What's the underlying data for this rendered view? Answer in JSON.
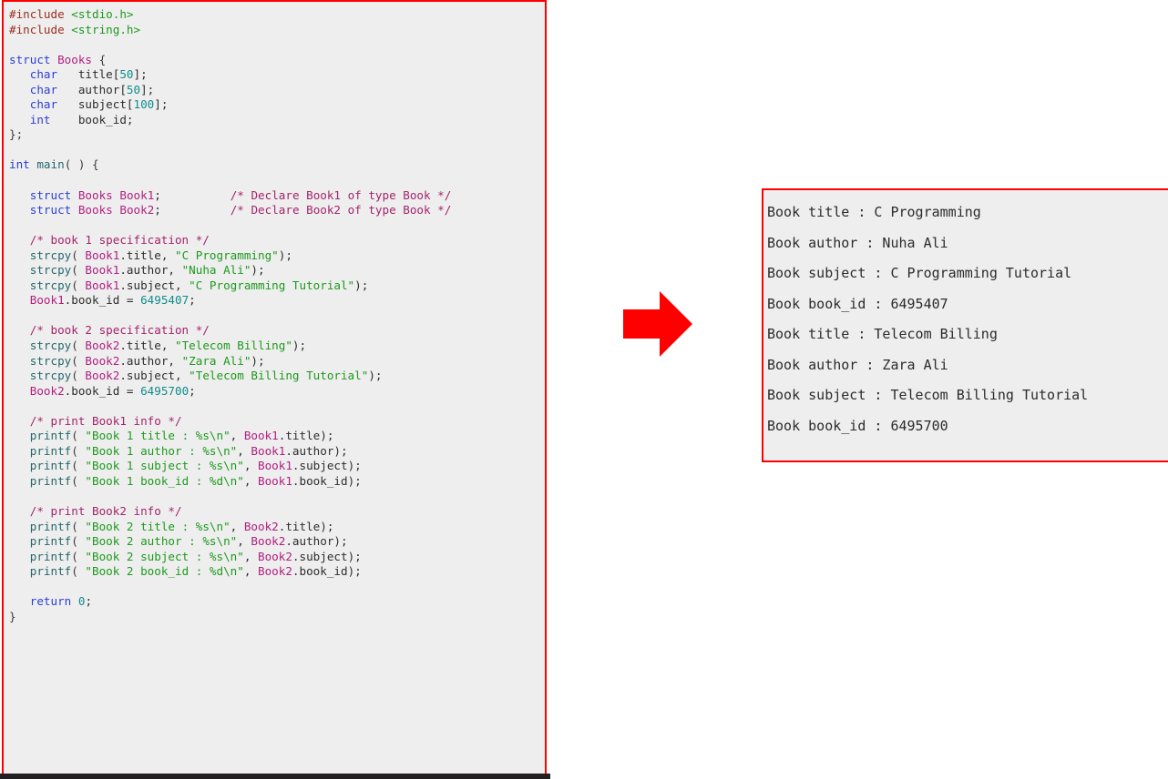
{
  "code_panel": {
    "language": "c",
    "border_color": "#fe0000",
    "background_color": "#eeeeee",
    "lines": [
      [
        {
          "t": "pre",
          "s": "#include "
        },
        {
          "t": "hdr",
          "s": "<stdio.h>"
        }
      ],
      [
        {
          "t": "pre",
          "s": "#include "
        },
        {
          "t": "hdr",
          "s": "<string.h>"
        }
      ],
      [],
      [
        {
          "t": "kw",
          "s": "struct"
        },
        {
          "t": "id",
          "s": " "
        },
        {
          "t": "type",
          "s": "Books"
        },
        {
          "t": "punc",
          "s": " {"
        }
      ],
      [
        {
          "t": "id",
          "s": "   "
        },
        {
          "t": "kw",
          "s": "char"
        },
        {
          "t": "id",
          "s": "   title["
        },
        {
          "t": "num",
          "s": "50"
        },
        {
          "t": "id",
          "s": "];"
        }
      ],
      [
        {
          "t": "id",
          "s": "   "
        },
        {
          "t": "kw",
          "s": "char"
        },
        {
          "t": "id",
          "s": "   author["
        },
        {
          "t": "num",
          "s": "50"
        },
        {
          "t": "id",
          "s": "];"
        }
      ],
      [
        {
          "t": "id",
          "s": "   "
        },
        {
          "t": "kw",
          "s": "char"
        },
        {
          "t": "id",
          "s": "   subject["
        },
        {
          "t": "num",
          "s": "100"
        },
        {
          "t": "id",
          "s": "];"
        }
      ],
      [
        {
          "t": "id",
          "s": "   "
        },
        {
          "t": "kw",
          "s": "int"
        },
        {
          "t": "id",
          "s": "    book_id;"
        }
      ],
      [
        {
          "t": "punc",
          "s": "};"
        }
      ],
      [],
      [
        {
          "t": "kw",
          "s": "int"
        },
        {
          "t": "id",
          "s": " "
        },
        {
          "t": "fn",
          "s": "main"
        },
        {
          "t": "punc",
          "s": "( ) {"
        }
      ],
      [],
      [
        {
          "t": "id",
          "s": "   "
        },
        {
          "t": "kw",
          "s": "struct"
        },
        {
          "t": "id",
          "s": " "
        },
        {
          "t": "type",
          "s": "Books"
        },
        {
          "t": "id",
          "s": " "
        },
        {
          "t": "type",
          "s": "Book1"
        },
        {
          "t": "id",
          "s": ";"
        },
        {
          "t": "id",
          "s": "          "
        },
        {
          "t": "cmt",
          "s": "/* Declare Book1 of type Book */"
        }
      ],
      [
        {
          "t": "id",
          "s": "   "
        },
        {
          "t": "kw",
          "s": "struct"
        },
        {
          "t": "id",
          "s": " "
        },
        {
          "t": "type",
          "s": "Books"
        },
        {
          "t": "id",
          "s": " "
        },
        {
          "t": "type",
          "s": "Book2"
        },
        {
          "t": "id",
          "s": ";"
        },
        {
          "t": "id",
          "s": "          "
        },
        {
          "t": "cmt",
          "s": "/* Declare Book2 of type Book */"
        }
      ],
      [],
      [
        {
          "t": "id",
          "s": "   "
        },
        {
          "t": "cmt",
          "s": "/* book 1 specification */"
        }
      ],
      [
        {
          "t": "id",
          "s": "   "
        },
        {
          "t": "fn",
          "s": "strcpy"
        },
        {
          "t": "punc",
          "s": "( "
        },
        {
          "t": "type",
          "s": "Book1"
        },
        {
          "t": "id",
          "s": ".title, "
        },
        {
          "t": "str",
          "s": "\"C Programming\""
        },
        {
          "t": "id",
          "s": ");"
        }
      ],
      [
        {
          "t": "id",
          "s": "   "
        },
        {
          "t": "fn",
          "s": "strcpy"
        },
        {
          "t": "punc",
          "s": "( "
        },
        {
          "t": "type",
          "s": "Book1"
        },
        {
          "t": "id",
          "s": ".author, "
        },
        {
          "t": "str",
          "s": "\"Nuha Ali\""
        },
        {
          "t": "id",
          "s": ");"
        }
      ],
      [
        {
          "t": "id",
          "s": "   "
        },
        {
          "t": "fn",
          "s": "strcpy"
        },
        {
          "t": "punc",
          "s": "( "
        },
        {
          "t": "type",
          "s": "Book1"
        },
        {
          "t": "id",
          "s": ".subject, "
        },
        {
          "t": "str",
          "s": "\"C Programming Tutorial\""
        },
        {
          "t": "id",
          "s": ");"
        }
      ],
      [
        {
          "t": "id",
          "s": "   "
        },
        {
          "t": "type",
          "s": "Book1"
        },
        {
          "t": "id",
          "s": ".book_id = "
        },
        {
          "t": "num",
          "s": "6495407"
        },
        {
          "t": "id",
          "s": ";"
        }
      ],
      [],
      [
        {
          "t": "id",
          "s": "   "
        },
        {
          "t": "cmt",
          "s": "/* book 2 specification */"
        }
      ],
      [
        {
          "t": "id",
          "s": "   "
        },
        {
          "t": "fn",
          "s": "strcpy"
        },
        {
          "t": "punc",
          "s": "( "
        },
        {
          "t": "type",
          "s": "Book2"
        },
        {
          "t": "id",
          "s": ".title, "
        },
        {
          "t": "str",
          "s": "\"Telecom Billing\""
        },
        {
          "t": "id",
          "s": ");"
        }
      ],
      [
        {
          "t": "id",
          "s": "   "
        },
        {
          "t": "fn",
          "s": "strcpy"
        },
        {
          "t": "punc",
          "s": "( "
        },
        {
          "t": "type",
          "s": "Book2"
        },
        {
          "t": "id",
          "s": ".author, "
        },
        {
          "t": "str",
          "s": "\"Zara Ali\""
        },
        {
          "t": "id",
          "s": ");"
        }
      ],
      [
        {
          "t": "id",
          "s": "   "
        },
        {
          "t": "fn",
          "s": "strcpy"
        },
        {
          "t": "punc",
          "s": "( "
        },
        {
          "t": "type",
          "s": "Book2"
        },
        {
          "t": "id",
          "s": ".subject, "
        },
        {
          "t": "str",
          "s": "\"Telecom Billing Tutorial\""
        },
        {
          "t": "id",
          "s": ");"
        }
      ],
      [
        {
          "t": "id",
          "s": "   "
        },
        {
          "t": "type",
          "s": "Book2"
        },
        {
          "t": "id",
          "s": ".book_id = "
        },
        {
          "t": "num",
          "s": "6495700"
        },
        {
          "t": "id",
          "s": ";"
        }
      ],
      [],
      [
        {
          "t": "id",
          "s": "   "
        },
        {
          "t": "cmt",
          "s": "/* print Book1 info */"
        }
      ],
      [
        {
          "t": "id",
          "s": "   "
        },
        {
          "t": "fn",
          "s": "printf"
        },
        {
          "t": "punc",
          "s": "( "
        },
        {
          "t": "str",
          "s": "\"Book 1 title : %s\\n\""
        },
        {
          "t": "id",
          "s": ", "
        },
        {
          "t": "type",
          "s": "Book1"
        },
        {
          "t": "id",
          "s": ".title);"
        }
      ],
      [
        {
          "t": "id",
          "s": "   "
        },
        {
          "t": "fn",
          "s": "printf"
        },
        {
          "t": "punc",
          "s": "( "
        },
        {
          "t": "str",
          "s": "\"Book 1 author : %s\\n\""
        },
        {
          "t": "id",
          "s": ", "
        },
        {
          "t": "type",
          "s": "Book1"
        },
        {
          "t": "id",
          "s": ".author);"
        }
      ],
      [
        {
          "t": "id",
          "s": "   "
        },
        {
          "t": "fn",
          "s": "printf"
        },
        {
          "t": "punc",
          "s": "( "
        },
        {
          "t": "str",
          "s": "\"Book 1 subject : %s\\n\""
        },
        {
          "t": "id",
          "s": ", "
        },
        {
          "t": "type",
          "s": "Book1"
        },
        {
          "t": "id",
          "s": ".subject);"
        }
      ],
      [
        {
          "t": "id",
          "s": "   "
        },
        {
          "t": "fn",
          "s": "printf"
        },
        {
          "t": "punc",
          "s": "( "
        },
        {
          "t": "str",
          "s": "\"Book 1 book_id : %d\\n\""
        },
        {
          "t": "id",
          "s": ", "
        },
        {
          "t": "type",
          "s": "Book1"
        },
        {
          "t": "id",
          "s": ".book_id);"
        }
      ],
      [],
      [
        {
          "t": "id",
          "s": "   "
        },
        {
          "t": "cmt",
          "s": "/* print Book2 info */"
        }
      ],
      [
        {
          "t": "id",
          "s": "   "
        },
        {
          "t": "fn",
          "s": "printf"
        },
        {
          "t": "punc",
          "s": "( "
        },
        {
          "t": "str",
          "s": "\"Book 2 title : %s\\n\""
        },
        {
          "t": "id",
          "s": ", "
        },
        {
          "t": "type",
          "s": "Book2"
        },
        {
          "t": "id",
          "s": ".title);"
        }
      ],
      [
        {
          "t": "id",
          "s": "   "
        },
        {
          "t": "fn",
          "s": "printf"
        },
        {
          "t": "punc",
          "s": "( "
        },
        {
          "t": "str",
          "s": "\"Book 2 author : %s\\n\""
        },
        {
          "t": "id",
          "s": ", "
        },
        {
          "t": "type",
          "s": "Book2"
        },
        {
          "t": "id",
          "s": ".author);"
        }
      ],
      [
        {
          "t": "id",
          "s": "   "
        },
        {
          "t": "fn",
          "s": "printf"
        },
        {
          "t": "punc",
          "s": "( "
        },
        {
          "t": "str",
          "s": "\"Book 2 subject : %s\\n\""
        },
        {
          "t": "id",
          "s": ", "
        },
        {
          "t": "type",
          "s": "Book2"
        },
        {
          "t": "id",
          "s": ".subject);"
        }
      ],
      [
        {
          "t": "id",
          "s": "   "
        },
        {
          "t": "fn",
          "s": "printf"
        },
        {
          "t": "punc",
          "s": "( "
        },
        {
          "t": "str",
          "s": "\"Book 2 book_id : %d\\n\""
        },
        {
          "t": "id",
          "s": ", "
        },
        {
          "t": "type",
          "s": "Book2"
        },
        {
          "t": "id",
          "s": ".book_id);"
        }
      ],
      [],
      [
        {
          "t": "id",
          "s": "   "
        },
        {
          "t": "kw",
          "s": "return"
        },
        {
          "t": "id",
          "s": " "
        },
        {
          "t": "num",
          "s": "0"
        },
        {
          "t": "id",
          "s": ";"
        }
      ],
      [
        {
          "t": "punc",
          "s": "}"
        }
      ]
    ]
  },
  "flow_arrow": {
    "icon": "right-arrow-icon",
    "color": "#fe0000",
    "direction": "right"
  },
  "output_panel": {
    "border_color": "#fe0000",
    "background_color": "#eeeeee",
    "lines": [
      "Book title : C Programming",
      "Book author : Nuha Ali",
      "Book subject : C Programming Tutorial",
      "Book book_id : 6495407",
      "Book title : Telecom Billing",
      "Book author : Zara Ali",
      "Book subject : Telecom Billing Tutorial",
      "Book book_id : 6495700"
    ]
  }
}
